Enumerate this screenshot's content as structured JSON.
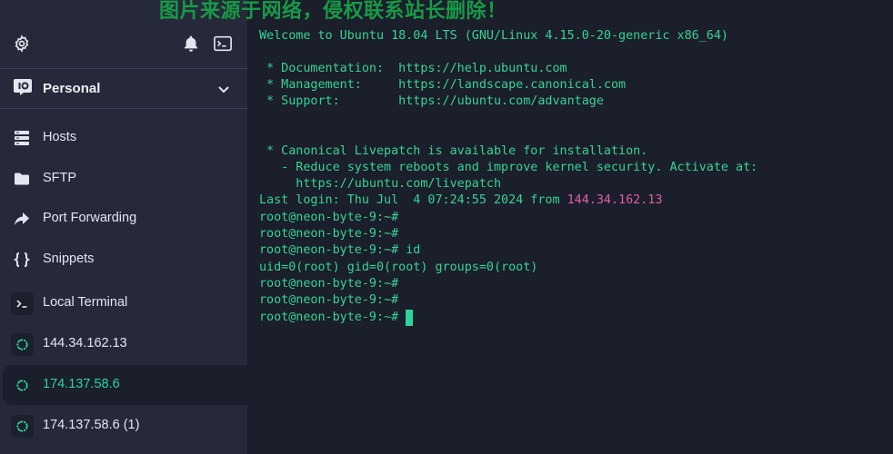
{
  "app": {
    "accent_color": "#2bd59a",
    "icons": {
      "settings": "gear-icon",
      "notifications": "bell-icon",
      "terminal": "terminal-icon"
    }
  },
  "vault": {
    "label": "Personal",
    "icon": "vault-icon",
    "chevron": "chevron-down-icon"
  },
  "nav": {
    "hosts": "Hosts",
    "sftp": "SFTP",
    "port_forwarding": "Port Forwarding",
    "snippets": "Snippets",
    "local_terminal": "Local Terminal"
  },
  "hosts": [
    {
      "label": "144.34.162.13",
      "icon": "ubuntu-icon",
      "active": false
    },
    {
      "label": "174.137.58.6",
      "icon": "ubuntu-icon",
      "active": true
    },
    {
      "label": "174.137.58.6 (1)",
      "icon": "ubuntu-icon",
      "active": false
    }
  ],
  "terminal": {
    "lines": {
      "l01": "Welcome to Ubuntu 18.04 LTS (GNU/Linux 4.15.0-20-generic x86_64)",
      "l03": " * Documentation:  https://help.ubuntu.com",
      "l04": " * Management:     https://landscape.canonical.com",
      "l05": " * Support:        https://ubuntu.com/advantage",
      "l08": " * Canonical Livepatch is available for installation.",
      "l09": "   - Reduce system reboots and improve kernel security. Activate at:",
      "l10": "     https://ubuntu.com/livepatch",
      "l11_prefix": "Last login: Thu Jul  4 07:24:55 2024 from ",
      "l11_ip": "144.34.162.13",
      "l12": "root@neon-byte-9:~#",
      "l13": "root@neon-byte-9:~#",
      "l14": "root@neon-byte-9:~# id",
      "l15": "uid=0(root) gid=0(root) groups=0(root)",
      "l16": "root@neon-byte-9:~#",
      "l17": "root@neon-byte-9:~#",
      "l18": "root@neon-byte-9:~# "
    },
    "text_color": "#36d493",
    "ip_color": "#e05fa0"
  },
  "watermark": "图片来源于网络，侵权联系站长删除！"
}
